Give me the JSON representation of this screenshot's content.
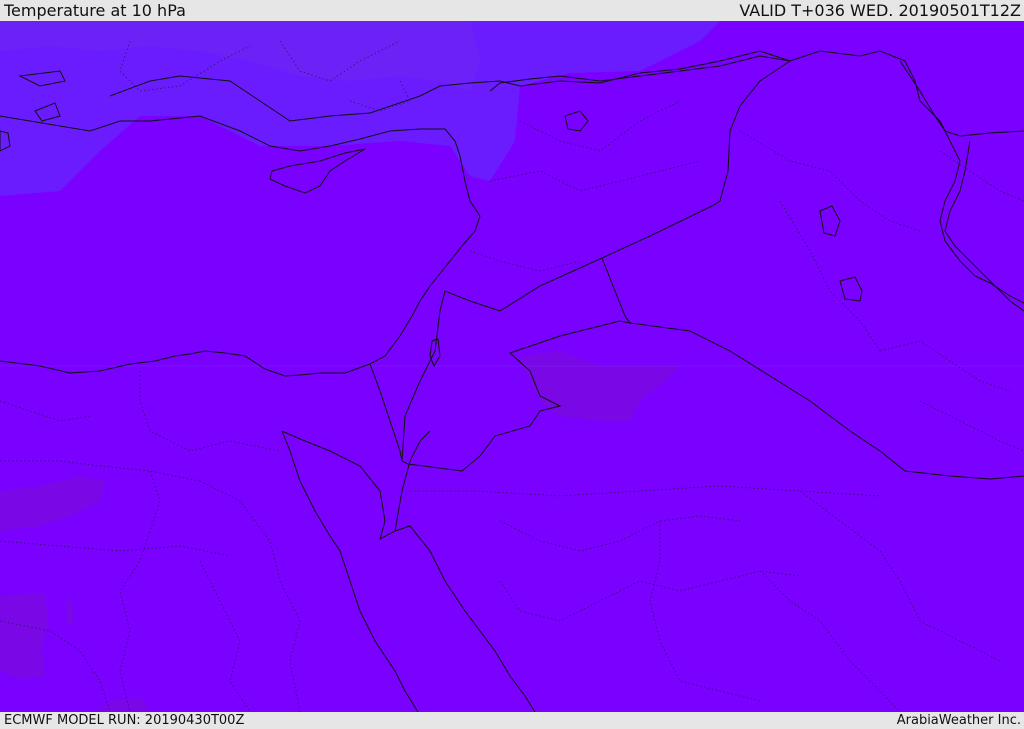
{
  "header": {
    "title": "Temperature at 10 hPa",
    "valid_time": "VALID T+036 WED. 20190501T12Z"
  },
  "footer": {
    "model_run": "ECMWF MODEL RUN: 20190430T00Z",
    "credit": "ArabiaWeather Inc."
  },
  "map": {
    "colors": {
      "base_field": "#7a00ff",
      "cool_field": "#6a1cff",
      "cooler_field": "#6d28f0",
      "warm_field": "#7a08e6",
      "border_line": "#101010",
      "coast_line": "#101010"
    }
  }
}
